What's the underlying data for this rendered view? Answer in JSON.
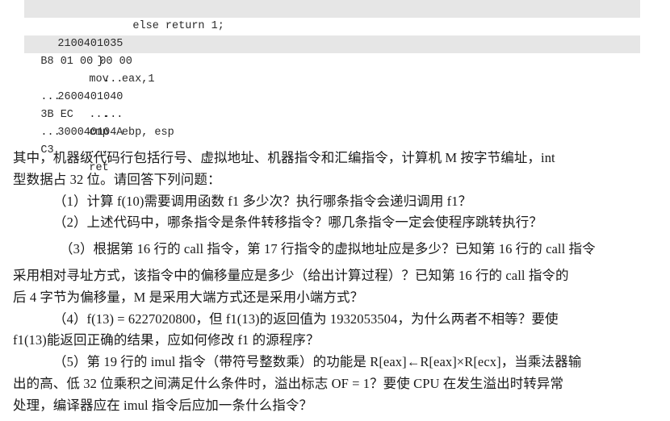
{
  "document": {
    "code_listing": {
      "rows": [
        {
          "kind": "source",
          "shaded": true,
          "text": "else return 1;"
        },
        {
          "kind": "asm",
          "shaded": false,
          "line_addr": "2100401035",
          "bytes": "B8 01 00 00 00",
          "asm": "mov  eax,1"
        },
        {
          "kind": "brace",
          "shaded": true,
          "text": "}"
        },
        {
          "kind": "asm",
          "shaded": false,
          "line_addr": "...",
          "bytes": "...",
          "asm": "..."
        },
        {
          "kind": "asm",
          "shaded": false,
          "line_addr": "2600401040",
          "bytes": "3B EC",
          "asm": "cmp  ebp, esp"
        },
        {
          "kind": "asm",
          "shaded": false,
          "line_addr": "...",
          "bytes": "...",
          "asm": "..."
        },
        {
          "kind": "asm",
          "shaded": false,
          "line_addr": "300040104A",
          "bytes": "C3",
          "asm": "ret"
        }
      ]
    },
    "prose": {
      "intro": [
        "其中，机器级代码行包括行号、虚拟地址、机器指令和汇编指令，计算机 M 按字节编址，int",
        "型数据占 32 位。请回答下列问题："
      ],
      "questions": [
        {
          "label": "（1）",
          "lines": [
            "（1）计算 f(10)需要调用函数 f1 多少次？执行哪条指令会递归调用 f1？"
          ]
        },
        {
          "label": "（2）",
          "lines": [
            "（2）上述代码中，哪条指令是条件转移指令？哪几条指令一定会使程序跳转执行？"
          ]
        },
        {
          "label": "（3）",
          "lines": [
            "（3）根据第 16 行的 call 指令，第 17 行指令的虚拟地址应是多少？已知第 16 行的 call 指令",
            "采用相对寻址方式，该指令中的偏移量应是多少（给出计算过程）？已知第 16 行的 call 指令的",
            "后 4 字节为偏移量，M 是采用大端方式还是采用小端方式？"
          ]
        },
        {
          "label": "（4）",
          "lines": [
            "（4）f(13) = 6227020800，但 f1(13)的返回值为 1932053504，为什么两者不相等？要使",
            "f1(13)能返回正确的结果，应如何修改 f1 的源程序？"
          ]
        },
        {
          "label": "（5）",
          "lines": [
            "（5）第 19 行的 imul 指令（带符号整数乘）的功能是 R[eax]←R[eax]×R[ecx]，当乘法器输",
            "出的高、低 32 位乘积之间满足什么条件时，溢出标志 OF = 1？要使 CPU 在发生溢出时转异常",
            "处理，编译器应在 imul 指令后应加一条什么指令？"
          ]
        }
      ]
    },
    "colors": {
      "page_background": "#ffffff",
      "code_row_shade": "#e6e6e6",
      "text": "#1a1a1a",
      "code_text": "#2b2b2b"
    }
  }
}
